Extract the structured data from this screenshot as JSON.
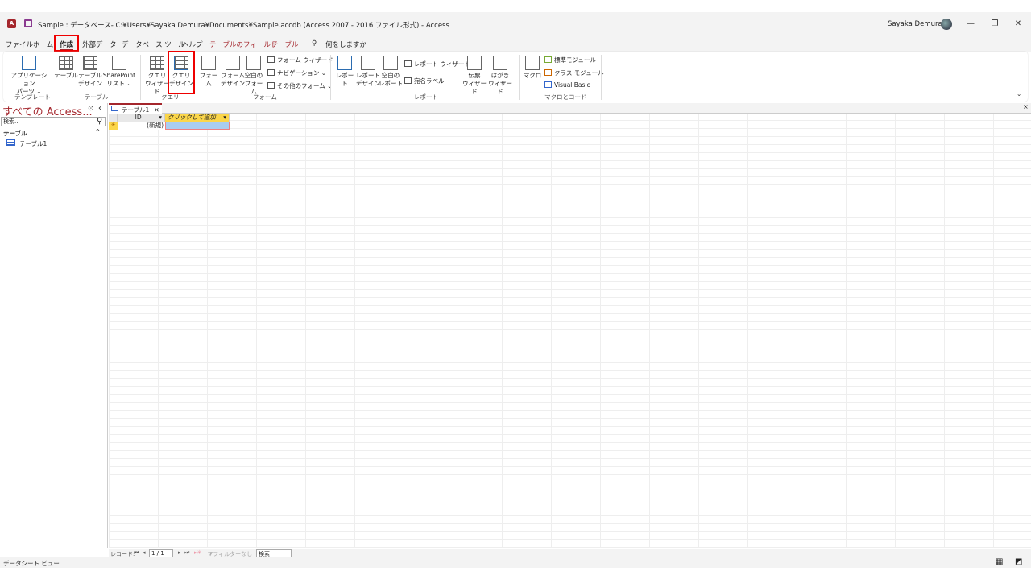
{
  "titlebar": {
    "title": "Sample : データベース- C:¥Users¥Sayaka Demura¥Documents¥Sample.accdb (Access 2007 - 2016 ファイル形式)  -  Access",
    "user": "Sayaka Demura",
    "app_icon": "A",
    "minimize": "—",
    "restore": "❐",
    "close": "✕"
  },
  "menu": [
    "ファイル",
    "ホーム",
    "作成",
    "外部データ",
    "データベース ツール",
    "ヘルプ",
    "テーブルのフィールド",
    "テーブル",
    "何をしますか"
  ],
  "ribbon": {
    "template": {
      "app_parts": "アプリケーション",
      "app_parts2": "パーツ ⌄",
      "group": "テンプレート"
    },
    "table": {
      "table": "テーブル",
      "design1": "テーブル",
      "design2": "デザイン",
      "sp1": "SharePoint",
      "sp2": "リスト ⌄",
      "group": "テーブル"
    },
    "query": {
      "wiz1": "クエリ",
      "wiz2": "ウィザード",
      "des1": "クエリ",
      "des2": "デザイン",
      "group": "クエリ"
    },
    "form": {
      "form": "フォーム",
      "des1": "フォーム",
      "des2": "デザイン",
      "blank1": "空白の",
      "blank2": "フォーム",
      "wizard": "フォーム ウィザード",
      "nav": "ナビゲーション ⌄",
      "other": "その他のフォーム ⌄",
      "group": "フォーム"
    },
    "report": {
      "report": "レポート",
      "des1": "レポート",
      "des2": "デザイン",
      "blank1": "空白の",
      "blank2": "レポート",
      "wizard": "レポート ウィザード",
      "label": "宛名ラベル",
      "slip1": "伝票",
      "slip2": "ウィザード",
      "post1": "はがき",
      "post2": "ウィザード",
      "group": "レポート"
    },
    "macro": {
      "macro": "マクロ",
      "module": "標準モジュール",
      "class": "クラス モジュール",
      "vb": "Visual Basic",
      "group": "マクロとコード"
    }
  },
  "nav": {
    "title": "すべての Access...",
    "search_placeholder": "検索...",
    "section": "テーブル",
    "items": [
      "テーブル1"
    ]
  },
  "tab": {
    "label": "テーブル1",
    "close": "✕"
  },
  "datasheet": {
    "columns": [
      "ID",
      "クリックして追加"
    ],
    "new_row": "(新規)"
  },
  "recnav": {
    "label": "レコード:",
    "position": "1 / 1",
    "filter": "フィルターなし",
    "search": "検索"
  },
  "status": {
    "view": "データシート ビュー"
  }
}
